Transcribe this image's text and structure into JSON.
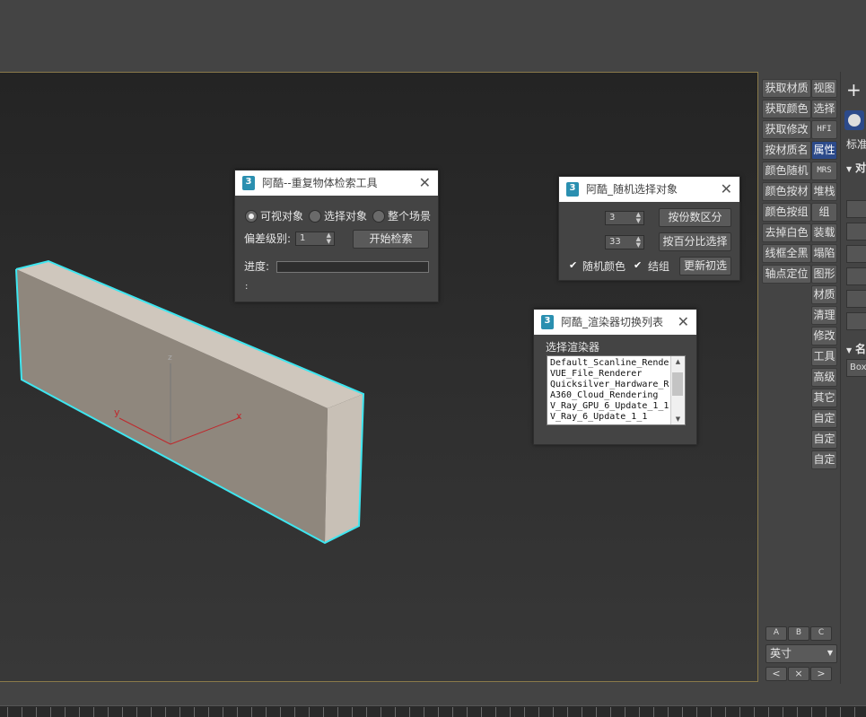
{
  "dialogs": {
    "duplicate": {
      "title": "阿酷--重复物体检索工具",
      "radios": [
        {
          "label": "可视对象",
          "selected": true
        },
        {
          "label": "选择对象",
          "selected": false
        },
        {
          "label": "整个场景",
          "selected": false
        }
      ],
      "tolerance_label": "偏差级别:",
      "tolerance_value": "1",
      "start_button": "开始检索",
      "progress_label": "进度:",
      "progress_value": 0,
      "status": ":"
    },
    "random_select": {
      "title": "阿酷_随机选择对象",
      "count_value": "3",
      "count_button": "按份数区分",
      "percent_value": "33",
      "percent_button": "按百分比选择",
      "random_color_label": "随机颜色",
      "group_label": "结组",
      "refresh_button": "更新初选"
    },
    "renderer": {
      "title": "阿酷_渲染器切换列表",
      "heading": "选择渲染器",
      "items": [
        "Default_Scanline_Rende",
        "VUE_File_Renderer",
        "Quicksilver_Hardware_R",
        "A360_Cloud_Rendering",
        "V_Ray_GPU_6_Update_1_1",
        "V_Ray_6_Update_1_1"
      ]
    }
  },
  "toolbar": {
    "col1": [
      "获取材质",
      "获取颜色",
      "获取修改",
      "按材质名",
      "颜色随机",
      "颜色按材",
      "颜色按组",
      "去掉白色",
      "线框全黑",
      "轴点定位"
    ],
    "col2": [
      "视图",
      "选择",
      "HFI",
      "属性",
      "MRS",
      "堆栈",
      "组",
      "装载",
      "塌陷",
      "图形",
      "材质",
      "清理",
      "修改",
      "工具",
      "高级",
      "其它",
      "自定",
      "自定",
      "自定"
    ],
    "active_col2_index": 3,
    "abc": [
      "A",
      "B",
      "C"
    ],
    "unit_value": "英寸",
    "nav": [
      "<",
      "×",
      ">"
    ]
  },
  "viewport": {
    "axis_x": "x",
    "axis_y": "y",
    "axis_z": "z"
  },
  "command_panel": {
    "plus": "+",
    "standard_label": "标准",
    "section1": "对",
    "section2": "名",
    "name_field": "Box"
  },
  "colors": {
    "selection_outline": "#3ee6f0",
    "box_face": "#8f877d",
    "box_top": "#cfc7bd",
    "active_button": "#2c4a8a"
  }
}
